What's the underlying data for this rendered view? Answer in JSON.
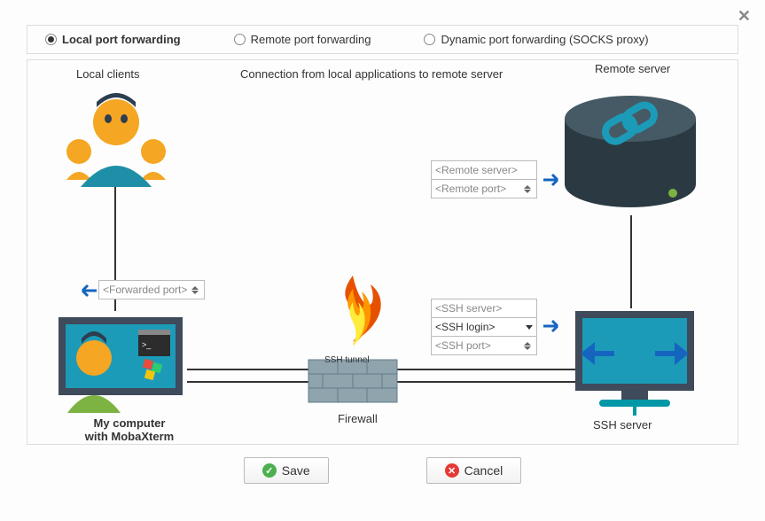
{
  "tabs": {
    "local": "Local port forwarding",
    "remote": "Remote port forwarding",
    "dynamic": "Dynamic port forwarding (SOCKS proxy)"
  },
  "labels": {
    "local_clients": "Local clients",
    "connection_desc": "Connection from local applications to remote server",
    "remote_server": "Remote server",
    "my_computer_l1": "My computer",
    "my_computer_l2": "with MobaXterm",
    "firewall": "Firewall",
    "ssh_tunnel": "SSH tunnel",
    "ssh_server": "SSH server"
  },
  "fields": {
    "forwarded_port": "<Forwarded port>",
    "remote_server": "<Remote server>",
    "remote_port": "<Remote port>",
    "ssh_server": "<SSH server>",
    "ssh_login": "<SSH login>",
    "ssh_port": "<SSH port>"
  },
  "buttons": {
    "save": "Save",
    "cancel": "Cancel"
  }
}
